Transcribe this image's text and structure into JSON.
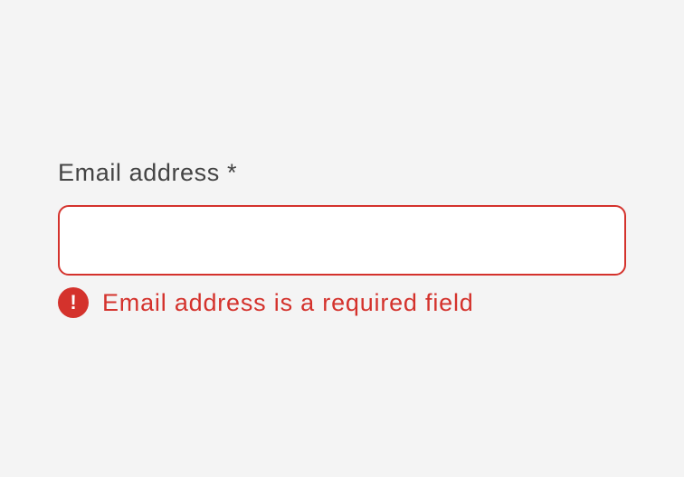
{
  "form": {
    "email": {
      "label": "Email address *",
      "value": "",
      "placeholder": "",
      "error": {
        "icon": "error-exclamation-icon",
        "icon_glyph": "!",
        "message": "Email address is a required field"
      }
    }
  },
  "colors": {
    "background": "#f4f4f4",
    "label": "#444444",
    "error": "#d4322c",
    "input_background": "#ffffff"
  }
}
